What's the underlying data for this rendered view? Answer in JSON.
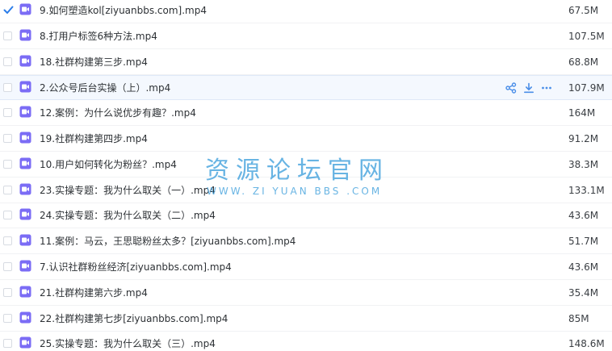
{
  "files": [
    {
      "name": "9.如何塑造kol[ziyuanbbs.com].mp4",
      "size": "67.5M",
      "checked": true,
      "hover": false
    },
    {
      "name": "8.打用户标签6种方法.mp4",
      "size": "107.5M",
      "checked": false,
      "hover": false
    },
    {
      "name": "18.社群构建第三步.mp4",
      "size": "68.8M",
      "checked": false,
      "hover": false
    },
    {
      "name": "2.公众号后台实操（上）.mp4",
      "size": "107.9M",
      "checked": false,
      "hover": true
    },
    {
      "name": "12.案例：为什么说优步有趣？.mp4",
      "size": "164M",
      "checked": false,
      "hover": false
    },
    {
      "name": "19.社群构建第四步.mp4",
      "size": "91.2M",
      "checked": false,
      "hover": false
    },
    {
      "name": "10.用户如何转化为粉丝？.mp4",
      "size": "38.3M",
      "checked": false,
      "hover": false
    },
    {
      "name": "23.实操专题：我为什么取关（一）.mp4",
      "size": "133.1M",
      "checked": false,
      "hover": false
    },
    {
      "name": "24.实操专题：我为什么取关（二）.mp4",
      "size": "43.6M",
      "checked": false,
      "hover": false
    },
    {
      "name": "11.案例：马云，王思聪粉丝太多？[ziyuanbbs.com].mp4",
      "size": "51.7M",
      "checked": false,
      "hover": false
    },
    {
      "name": "7.认识社群粉丝经济[ziyuanbbs.com].mp4",
      "size": "43.6M",
      "checked": false,
      "hover": false
    },
    {
      "name": "21.社群构建第六步.mp4",
      "size": "35.4M",
      "checked": false,
      "hover": false
    },
    {
      "name": "22.社群构建第七步[ziyuanbbs.com].mp4",
      "size": "85M",
      "checked": false,
      "hover": false
    },
    {
      "name": "25.实操专题：我为什么取关（三）.mp4",
      "size": "148.6M",
      "checked": false,
      "hover": false
    }
  ],
  "row_actions": [
    "share-icon",
    "download-icon",
    "more-icon"
  ],
  "watermark": {
    "cn": "资源论坛官网",
    "en": "WWW. ZI YUAN BBS .COM"
  },
  "colors": {
    "video_icon": "#7b6cf5",
    "check": "#2b7de9",
    "action": "#4a8ee8",
    "watermark": "#48a4de"
  }
}
